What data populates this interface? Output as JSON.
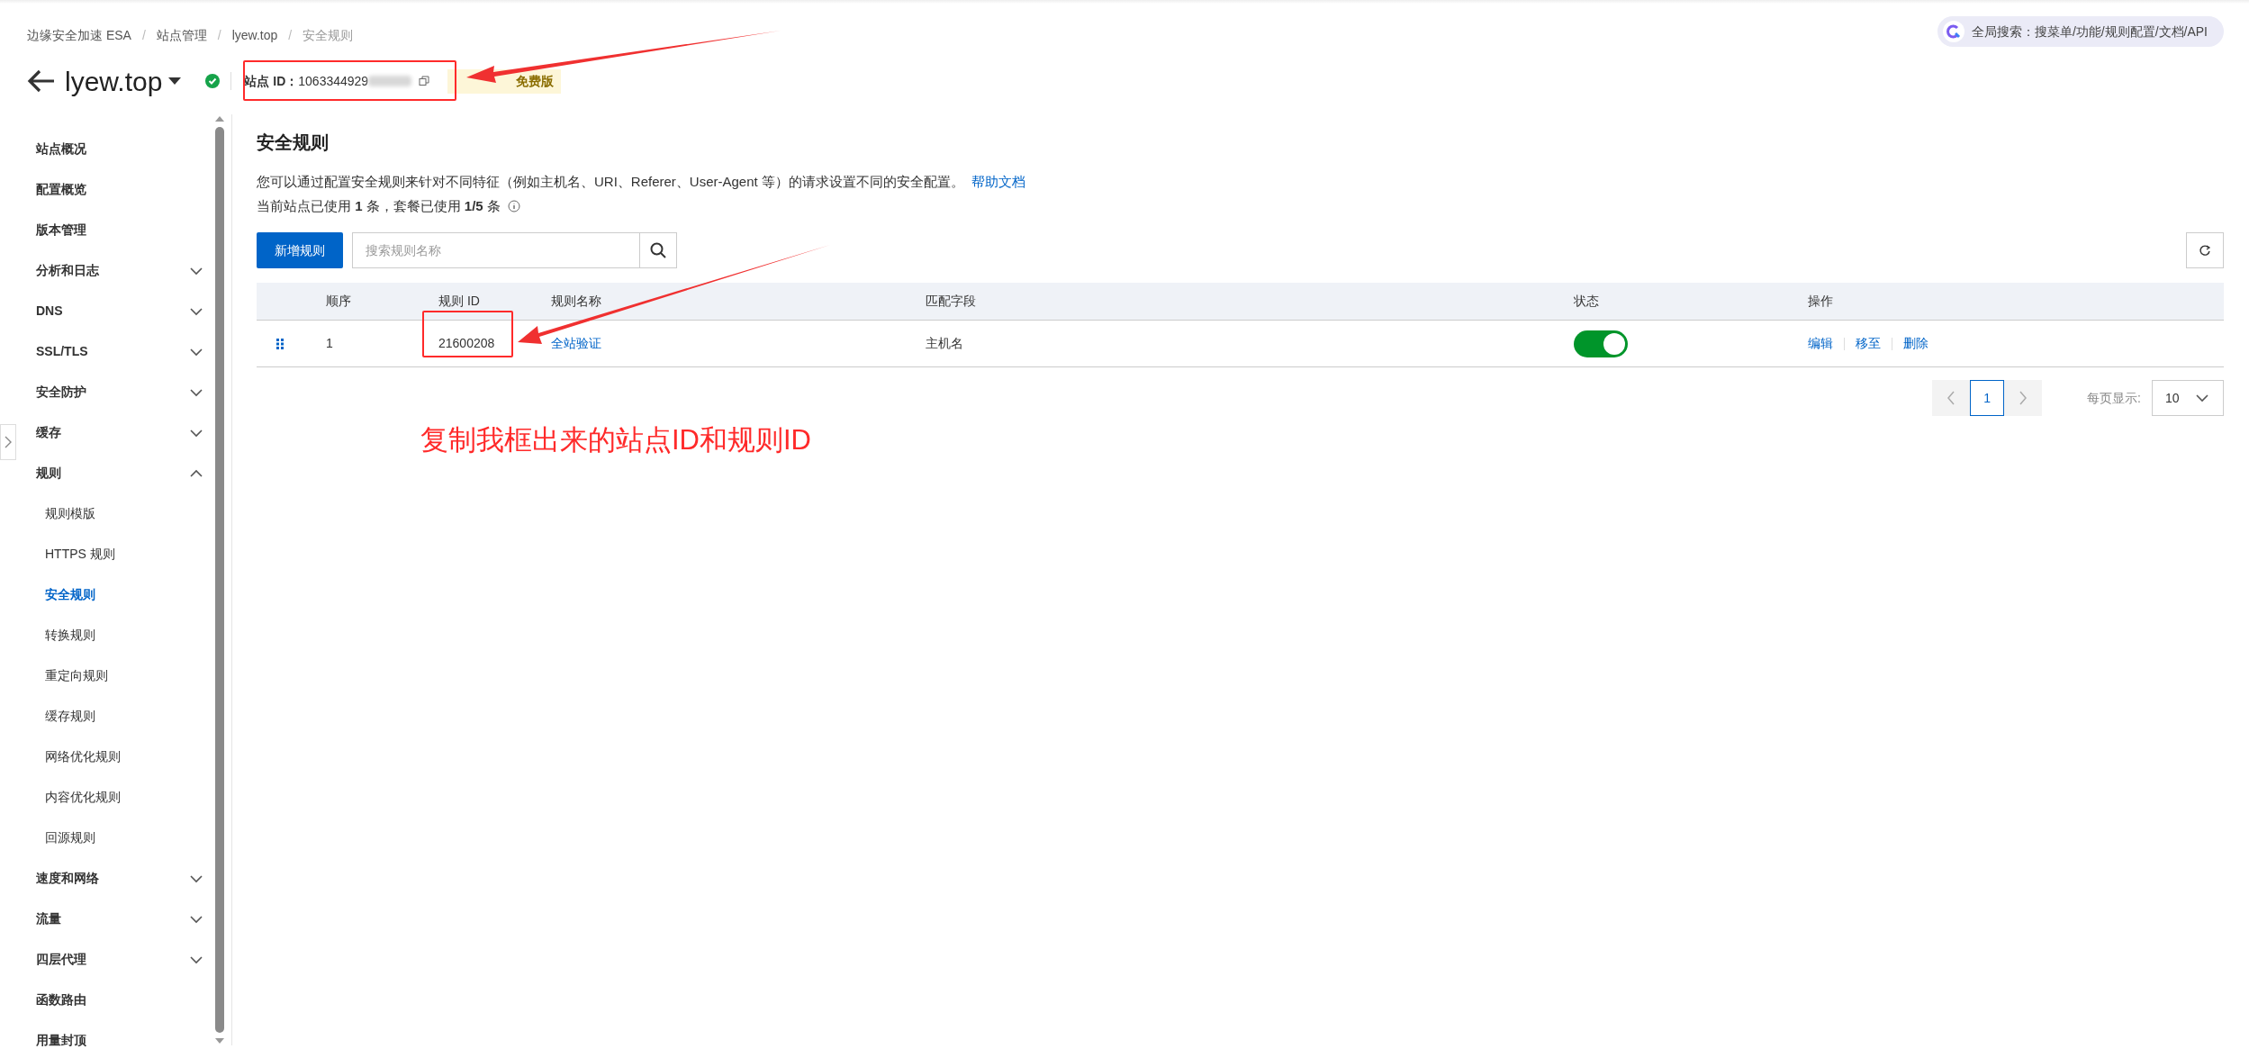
{
  "breadcrumb": [
    "边缘安全加速 ESA",
    "站点管理",
    "lyew.top",
    "安全规则"
  ],
  "breadcrumb_separator": "/",
  "global_search": {
    "placeholder": "全局搜索：搜菜单/功能/规则配置/文档/API"
  },
  "site": {
    "name": "lyew.top",
    "id_label": "站点 ID：",
    "id_visible": "1063344929",
    "plan": "免费版"
  },
  "sidebar": {
    "items": [
      {
        "label": "站点概况",
        "kind": "link"
      },
      {
        "label": "配置概览",
        "kind": "link"
      },
      {
        "label": "版本管理",
        "kind": "link"
      },
      {
        "label": "分析和日志",
        "kind": "group",
        "expanded": false
      },
      {
        "label": "DNS",
        "kind": "group",
        "expanded": false
      },
      {
        "label": "SSL/TLS",
        "kind": "group",
        "expanded": false
      },
      {
        "label": "安全防护",
        "kind": "group",
        "expanded": false
      },
      {
        "label": "缓存",
        "kind": "group",
        "expanded": false
      },
      {
        "label": "规则",
        "kind": "group",
        "expanded": true,
        "children": [
          {
            "label": "规则模版",
            "selected": false
          },
          {
            "label": "HTTPS 规则",
            "selected": false
          },
          {
            "label": "安全规则",
            "selected": true
          },
          {
            "label": "转换规则",
            "selected": false
          },
          {
            "label": "重定向规则",
            "selected": false
          },
          {
            "label": "缓存规则",
            "selected": false
          },
          {
            "label": "网络优化规则",
            "selected": false
          },
          {
            "label": "内容优化规则",
            "selected": false
          },
          {
            "label": "回源规则",
            "selected": false
          }
        ]
      },
      {
        "label": "速度和网络",
        "kind": "group",
        "expanded": false
      },
      {
        "label": "流量",
        "kind": "group",
        "expanded": false
      },
      {
        "label": "四层代理",
        "kind": "group",
        "expanded": false
      },
      {
        "label": "函数路由",
        "kind": "link"
      },
      {
        "label": "用量封顶",
        "kind": "link"
      }
    ]
  },
  "page": {
    "title": "安全规则",
    "description": "您可以通过配置安全规则来针对不同特征（例如主机名、URI、Referer、User-Agent 等）的请求设置不同的安全配置。",
    "help_link": "帮助文档",
    "usage": "当前站点已使用 **1** 条，套餐已使用 **1/5** 条"
  },
  "toolbar": {
    "add_button": "新增规则",
    "search": {
      "placeholder": "搜索规则名称"
    }
  },
  "table": {
    "columns": [
      "顺序",
      "规则 ID",
      "规则名称",
      "匹配字段",
      "状态",
      "操作"
    ],
    "rows": [
      {
        "order": "1",
        "rule_id": "21600208",
        "name": "全站验证",
        "match_field": "主机名",
        "on": true,
        "actions": [
          "编辑",
          "移至",
          "删除"
        ]
      }
    ]
  },
  "pagination": {
    "pages": [
      {
        "label": "1",
        "selected": true
      }
    ],
    "page_size_label": "每页显示:",
    "page_size": "10"
  },
  "annotation": {
    "text": "复制我框出来的站点ID和规则ID"
  }
}
